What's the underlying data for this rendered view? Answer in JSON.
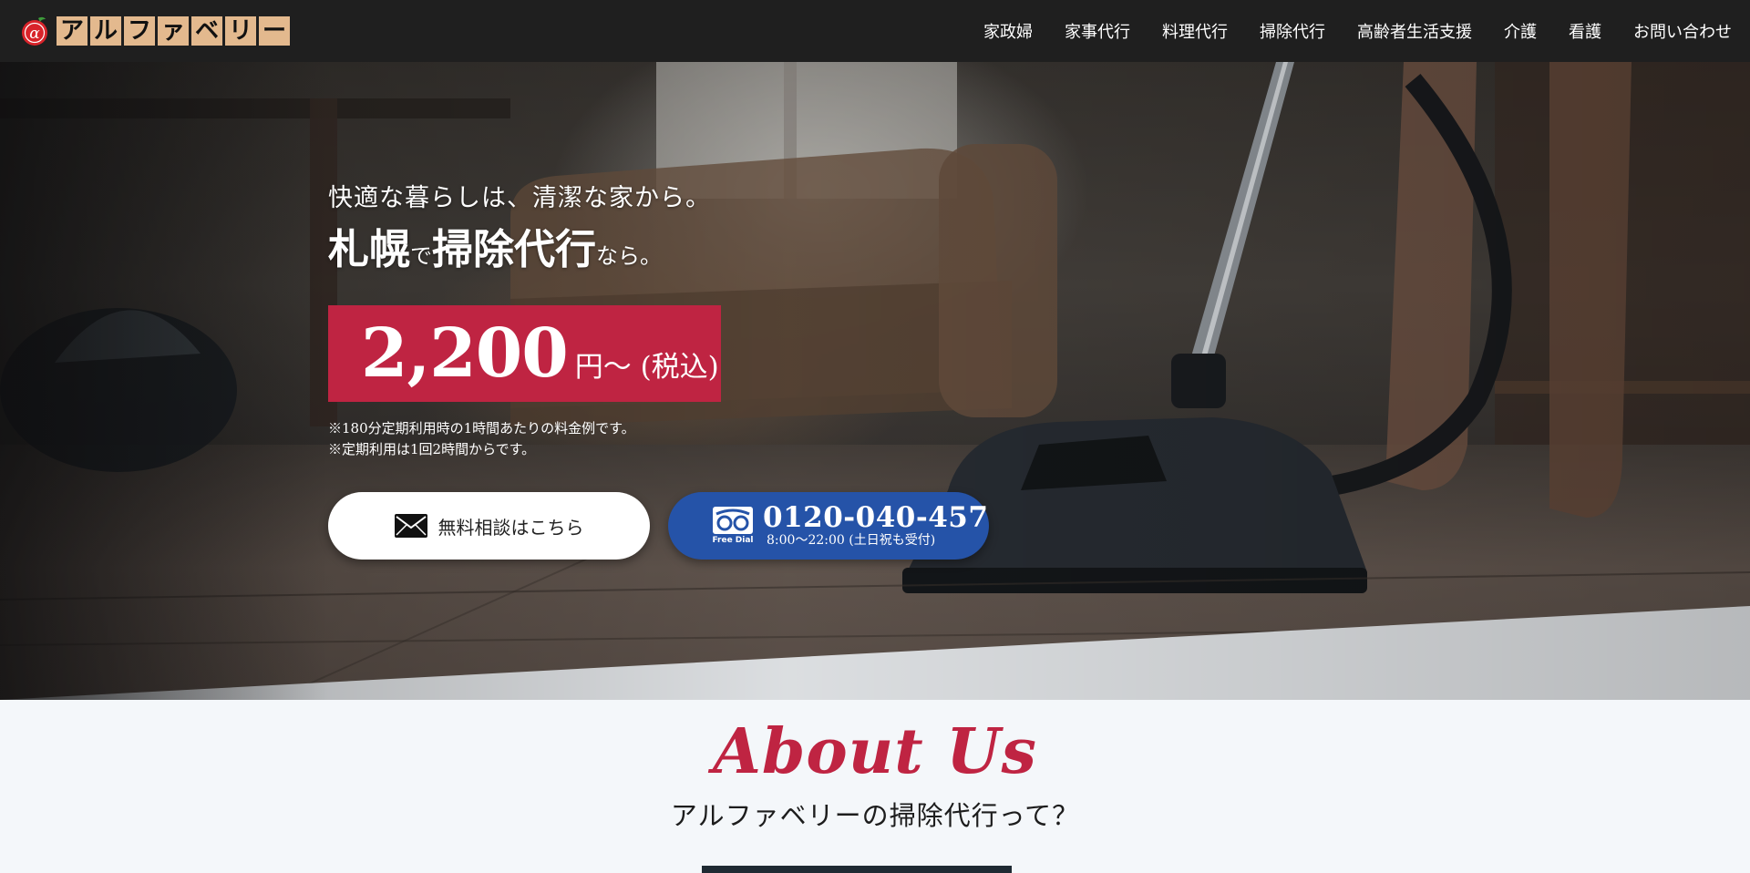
{
  "header": {
    "logo_chars": [
      "ア",
      "ル",
      "フ",
      "ァ",
      "ベ",
      "リ",
      "ー"
    ],
    "logo_mark_char": "α",
    "nav": [
      {
        "label": "家政婦"
      },
      {
        "label": "家事代行"
      },
      {
        "label": "料理代行"
      },
      {
        "label": "掃除代行"
      },
      {
        "label": "高齢者生活支援"
      },
      {
        "label": "介護"
      },
      {
        "label": "看護"
      },
      {
        "label": "お問い合わせ"
      }
    ]
  },
  "hero": {
    "subtitle": "快適な暮らしは、清潔な家から。",
    "title_part1": "札幌",
    "title_part2": "で",
    "title_part3": "掃除代行",
    "title_part4": "なら。",
    "price": "2,200",
    "price_unit": "円〜 (税込)",
    "note1": "※180分定期利用時の1時間あたりの料金例です。",
    "note2": "※定期利用は1回2時間からです。",
    "consult_button": "無料相談はこちら",
    "freedial_label": "Free Dial",
    "phone_number": "0120-040-457",
    "phone_hours": "8:00〜22:00 (土日祝も受付)"
  },
  "about": {
    "title": "About Us",
    "subtitle": "アルファベリーの掃除代行って？"
  },
  "colors": {
    "accent_red": "#bf2442",
    "phone_blue": "#2553a8",
    "header_bg": "#1f1f1f",
    "logo_tile": "#e3b98e"
  },
  "icons": {
    "mail": "mail-icon",
    "freedial": "freedial-icon"
  }
}
